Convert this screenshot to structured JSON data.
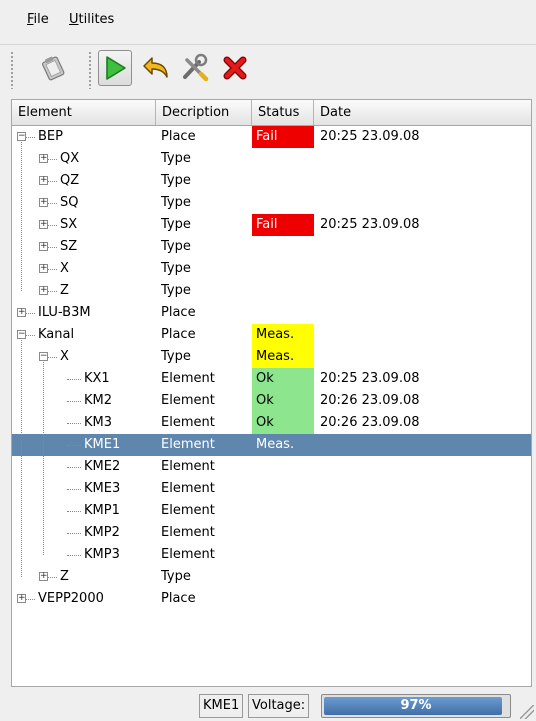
{
  "menubar": {
    "file": {
      "mnemonic": "F",
      "rest": "ile"
    },
    "utilites": {
      "mnemonic": "U",
      "rest": "tilites"
    }
  },
  "toolbar": {
    "buttons": [
      {
        "icon": "clipboard-icon"
      },
      {
        "icon": "play-icon",
        "active": true,
        "color": "#2e9e2e"
      },
      {
        "icon": "undo-arrow-icon",
        "color": "#e8a818"
      },
      {
        "icon": "tools-icon"
      },
      {
        "icon": "close-x-icon",
        "color": "#dd1111"
      }
    ]
  },
  "tree": {
    "columns": [
      "Element",
      "Decription",
      "Status",
      "Date"
    ],
    "rows": [
      {
        "name": "BEP",
        "desc": "Place",
        "status": "Fail",
        "date": "20:25 23.09.08"
      },
      {
        "name": "QX",
        "desc": "Type",
        "status": "",
        "date": ""
      },
      {
        "name": "QZ",
        "desc": "Type",
        "status": "",
        "date": ""
      },
      {
        "name": "SQ",
        "desc": "Type",
        "status": "",
        "date": ""
      },
      {
        "name": "SX",
        "desc": "Type",
        "status": "Fail",
        "date": "20:25 23.09.08"
      },
      {
        "name": "SZ",
        "desc": "Type",
        "status": "",
        "date": ""
      },
      {
        "name": "X",
        "desc": "Type",
        "status": "",
        "date": ""
      },
      {
        "name": "Z",
        "desc": "Type",
        "status": "",
        "date": ""
      },
      {
        "name": "ILU-B3M",
        "desc": "Place",
        "status": "",
        "date": ""
      },
      {
        "name": "Kanal",
        "desc": "Place",
        "status": "Meas.",
        "date": ""
      },
      {
        "name": "X",
        "desc": "Type",
        "status": "Meas.",
        "date": ""
      },
      {
        "name": "KX1",
        "desc": "Element",
        "status": "Ok",
        "date": "20:25 23.09.08"
      },
      {
        "name": "KM2",
        "desc": "Element",
        "status": "Ok",
        "date": "20:26 23.09.08"
      },
      {
        "name": "KM3",
        "desc": "Element",
        "status": "Ok",
        "date": "20:26 23.09.08"
      },
      {
        "name": "KME1",
        "desc": "Element",
        "status": "Meas.",
        "date": "",
        "selected": true
      },
      {
        "name": "KME2",
        "desc": "Element",
        "status": "",
        "date": ""
      },
      {
        "name": "KME3",
        "desc": "Element",
        "status": "",
        "date": ""
      },
      {
        "name": "KMP1",
        "desc": "Element",
        "status": "",
        "date": ""
      },
      {
        "name": "KMP2",
        "desc": "Element",
        "status": "",
        "date": ""
      },
      {
        "name": "KMP3",
        "desc": "Element",
        "status": "",
        "date": ""
      },
      {
        "name": "Z",
        "desc": "Type",
        "status": "",
        "date": ""
      },
      {
        "name": "VEPP2000",
        "desc": "Place",
        "status": "",
        "date": ""
      }
    ]
  },
  "statusbar": {
    "current": "KME1",
    "voltage_label": "Voltage:",
    "progress": 0.97,
    "progress_text": "97%"
  }
}
